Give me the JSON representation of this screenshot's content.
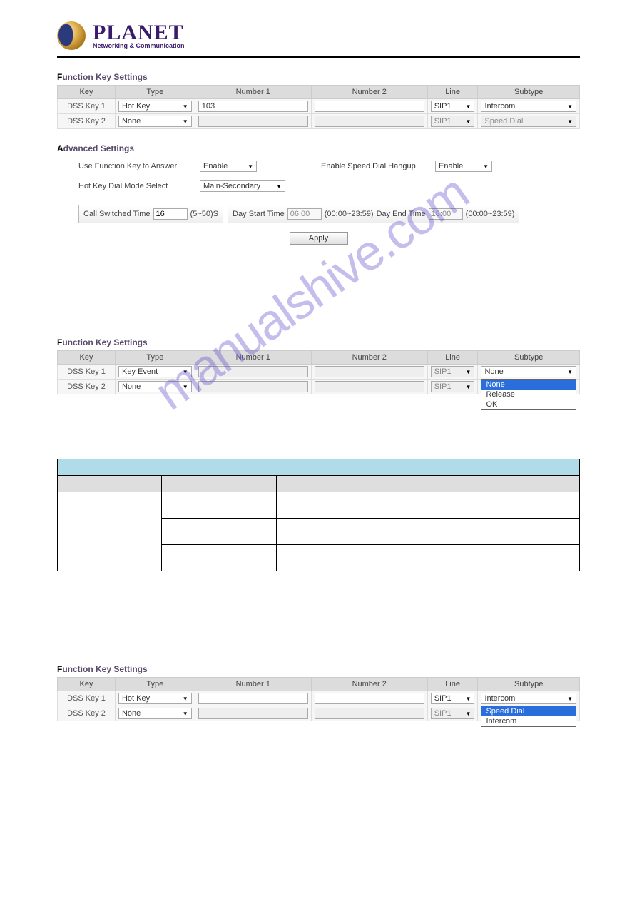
{
  "logo": {
    "brand": "PLANET",
    "tagline": "Networking & Communication"
  },
  "watermark": "manualshive.com",
  "sections": {
    "fk1": {
      "title": "Function Key Settings",
      "headers": {
        "key": "Key",
        "type": "Type",
        "num1": "Number 1",
        "num2": "Number 2",
        "line": "Line",
        "subtype": "Subtype"
      },
      "rows": [
        {
          "key": "DSS Key 1",
          "type": "Hot Key",
          "num1": "103",
          "num2": "",
          "line": "SIP1",
          "subtype": "Intercom",
          "disabled": {
            "type": false,
            "num1": false,
            "num2": false,
            "line": false,
            "subtype": false
          }
        },
        {
          "key": "DSS Key 2",
          "type": "None",
          "num1": "",
          "num2": "",
          "line": "SIP1",
          "subtype": "Speed Dial",
          "disabled": {
            "type": false,
            "num1": true,
            "num2": true,
            "line": true,
            "subtype": true
          }
        }
      ]
    },
    "adv": {
      "title": "Advanced Settings",
      "use_fk_answer_label": "Use Function Key to Answer",
      "use_fk_answer_value": "Enable",
      "speed_dial_hangup_label": "Enable Speed Dial Hangup",
      "speed_dial_hangup_value": "Enable",
      "hotkey_mode_label": "Hot Key Dial Mode Select",
      "hotkey_mode_value": "Main-Secondary",
      "call_switched_label": "Call Switched Time",
      "call_switched_value": "16",
      "call_switched_range": "(5~50)S",
      "day_start_label": "Day Start Time",
      "day_start_value": "06:00",
      "day_range1": "(00:00~23:59)",
      "day_end_label": "Day End Time",
      "day_end_value": "18:00",
      "day_range2": "(00:00~23:59)",
      "apply": "Apply"
    },
    "fk2": {
      "title": "Function Key Settings",
      "rows": [
        {
          "key": "DSS Key 1",
          "type": "Key Event",
          "num1": "",
          "num2": "",
          "line": "SIP1",
          "subtype": "None",
          "disabled": {
            "type": false,
            "num1": true,
            "num2": true,
            "line": true,
            "subtype": false
          }
        },
        {
          "key": "DSS Key 2",
          "type": "None",
          "num1": "",
          "num2": "",
          "line": "SIP1",
          "subtype": "",
          "disabled": {
            "type": false,
            "num1": true,
            "num2": true,
            "line": true,
            "subtype": true
          }
        }
      ],
      "dropdown": [
        "None",
        "Release",
        "OK"
      ],
      "dropdown_hl": 0
    },
    "fk3": {
      "title": "Function Key Settings",
      "rows": [
        {
          "key": "DSS Key 1",
          "type": "Hot Key",
          "num1": "",
          "num2": "",
          "line": "SIP1",
          "subtype": "Intercom",
          "disabled": {
            "type": false,
            "num1": false,
            "num2": false,
            "line": false,
            "subtype": false
          }
        },
        {
          "key": "DSS Key 2",
          "type": "None",
          "num1": "",
          "num2": "",
          "line": "SIP1",
          "subtype": "",
          "disabled": {
            "type": false,
            "num1": true,
            "num2": true,
            "line": true,
            "subtype": true
          }
        }
      ],
      "dropdown": [
        "Speed Dial",
        "Intercom"
      ],
      "dropdown_hl": 0
    }
  }
}
